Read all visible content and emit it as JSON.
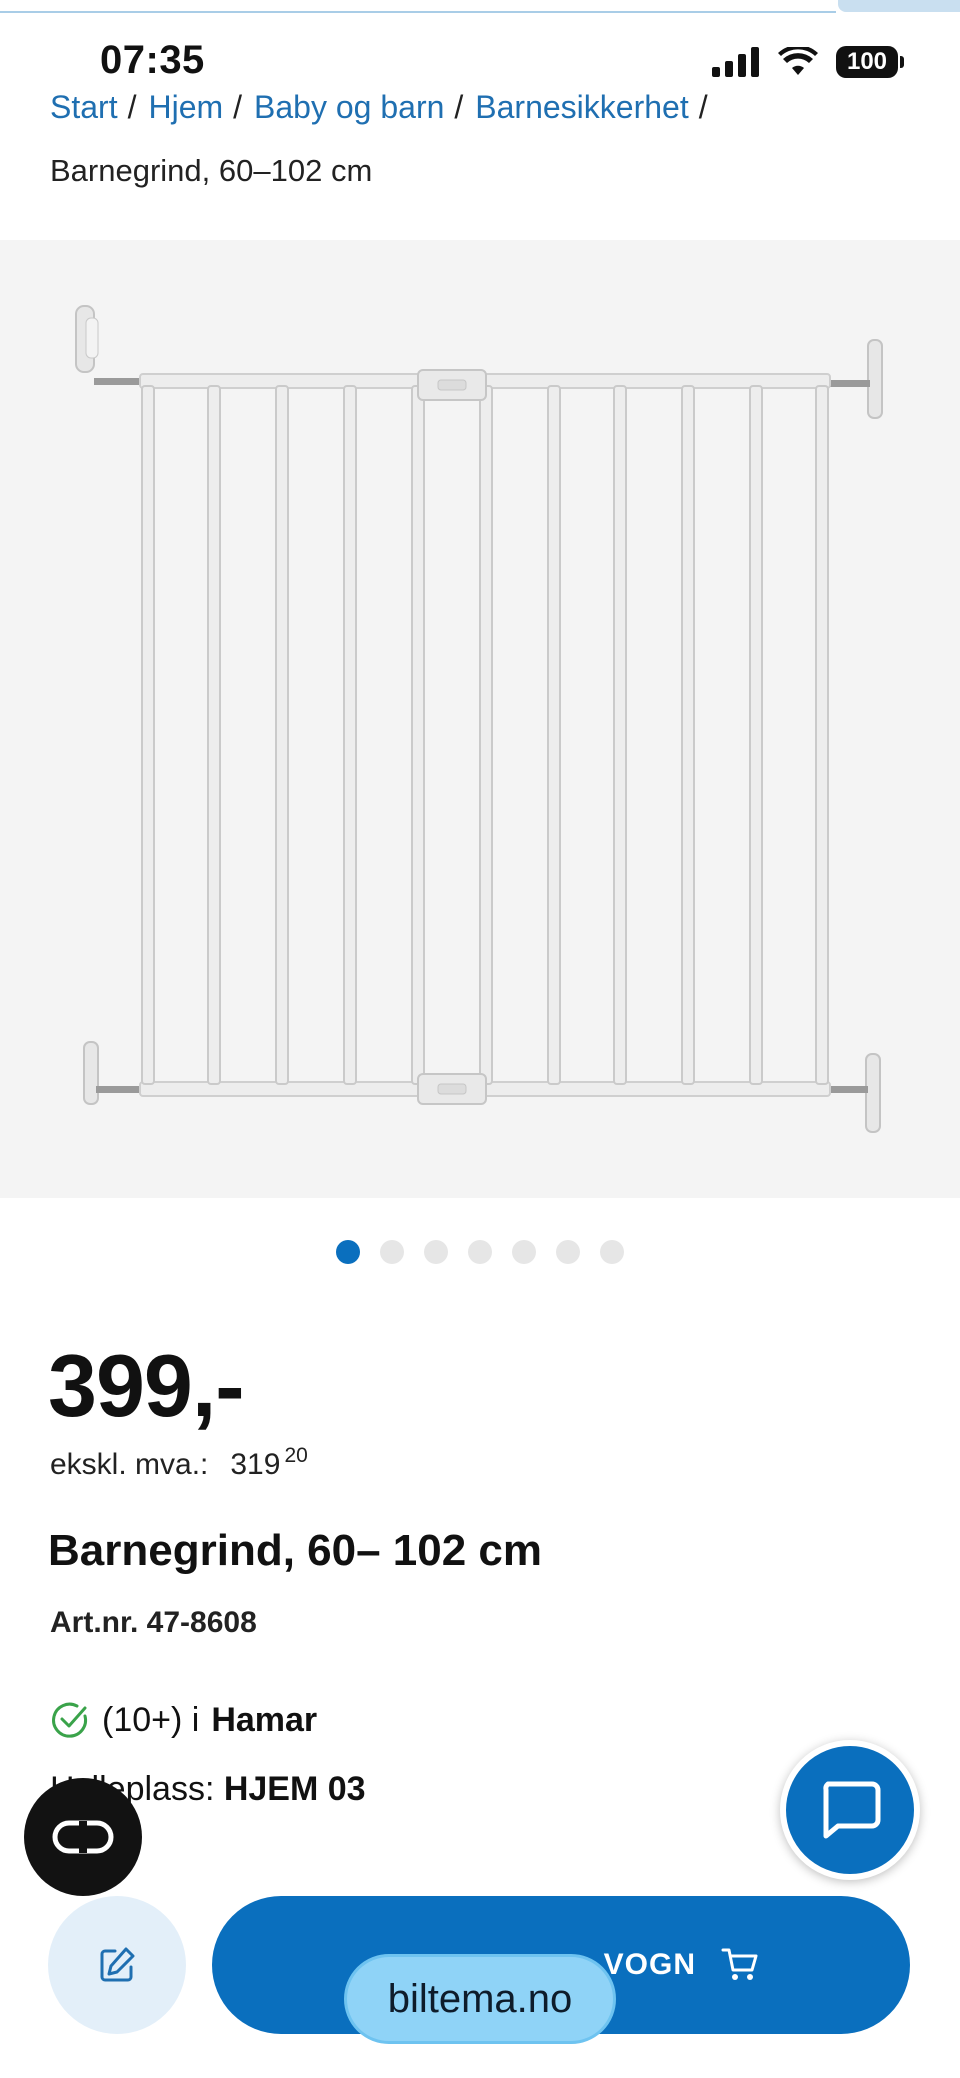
{
  "status_bar": {
    "time": "07:35",
    "battery": "100"
  },
  "breadcrumb": {
    "items": [
      "Start",
      "Hjem",
      "Baby og barn",
      "Barnesikkerhet"
    ],
    "separator": "/",
    "current": "Barnegrind, 60–102 cm"
  },
  "gallery": {
    "total_images": 7,
    "active_index": 0
  },
  "product": {
    "price": "399,-",
    "ex_vat_label": "ekskl. mva.:",
    "ex_vat_whole": "319",
    "ex_vat_decimal": "20",
    "title": "Barnegrind, 60– 102 cm",
    "art_nr": "Art.nr. 47-8608",
    "stock_count": "(10+) i",
    "stock_store": "Hamar",
    "shelf_label": "Hylleplass:",
    "shelf_value": "HJEM 03"
  },
  "actions": {
    "cart_label": "VOGN",
    "url": "biltema.no"
  },
  "colors": {
    "accent": "#0a6fbe",
    "link": "#1f6fb1",
    "stock_ok": "#3aa34a"
  }
}
